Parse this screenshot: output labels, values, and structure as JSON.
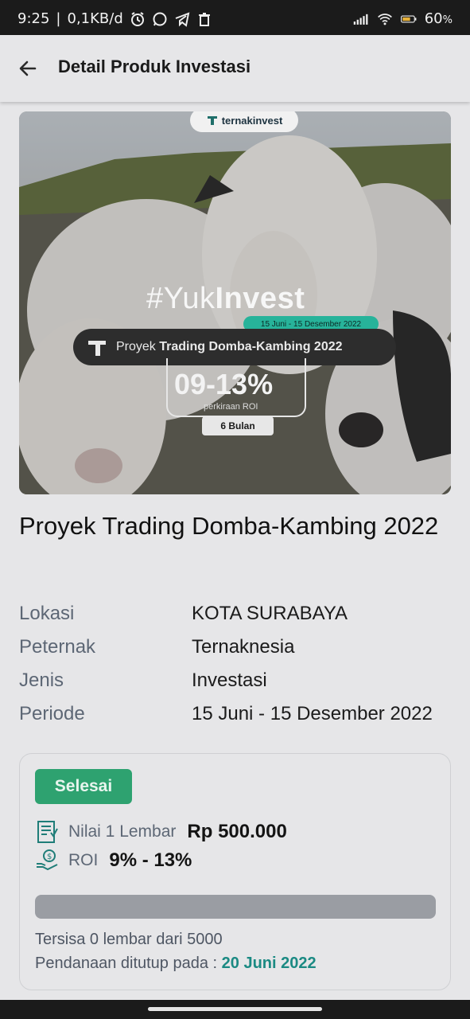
{
  "status_bar": {
    "time": "9:25",
    "net_speed": "0,1KB/d",
    "battery": "60",
    "battery_unit": "%",
    "icons": [
      "alarm-icon",
      "whatsapp-icon",
      "telegram-icon",
      "trash-icon",
      "signal-icon",
      "wifi-icon",
      "battery-icon"
    ]
  },
  "app_bar": {
    "title": "Detail Produk Investasi",
    "back_icon": "arrow-left-icon"
  },
  "hero": {
    "brand": "ternakinvest",
    "hashtag_prefix": "#Yuk",
    "hashtag_bold": "Invest",
    "date_range": "15 Juni - 15 Desember 2022",
    "project_prefix": "Proyek ",
    "project_bold": "Trading Domba-Kambing 2022",
    "roi": "09-13%",
    "roi_caption": "perkiraan ROI",
    "duration": "6 Bulan"
  },
  "product": {
    "title": "Proyek Trading Domba-Kambing 2022",
    "info": [
      {
        "key": "Lokasi",
        "value": "KOTA SURABAYA"
      },
      {
        "key": "Peternak",
        "value": "Ternaknesia"
      },
      {
        "key": "Jenis",
        "value": "Investasi"
      },
      {
        "key": "Periode",
        "value": "15 Juni - 15 Desember 2022"
      }
    ]
  },
  "card": {
    "status": "Selesai",
    "nilai_label": "Nilai 1 Lembar",
    "nilai_value": "Rp 500.000",
    "roi_label": "ROI",
    "roi_value": "9% - 13%",
    "progress_fraction": 0,
    "sisa_text": "Tersisa 0 lembar dari 5000",
    "tutup_label": "Pendanaan ditutup pada :",
    "tutup_date": "20 Juni 2022",
    "colors": {
      "status_green": "#2ea270",
      "date_teal": "#1b8a83"
    }
  }
}
